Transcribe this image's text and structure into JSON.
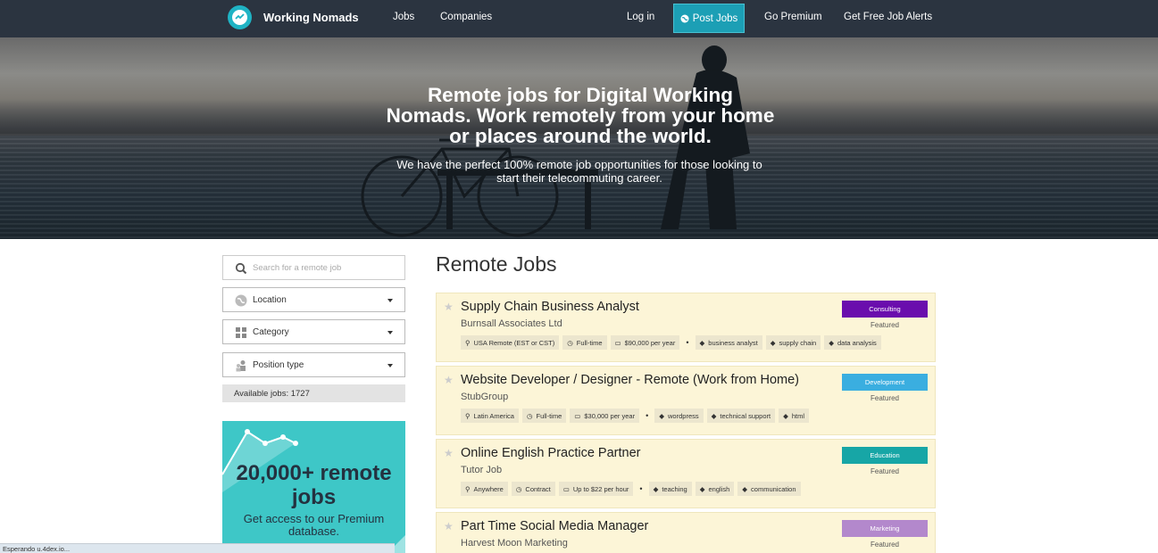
{
  "nav": {
    "brand": "Working Nomads",
    "links": [
      "Jobs",
      "Companies",
      "Log in",
      "Post Jobs",
      "Go Premium",
      "Get Free Job Alerts"
    ]
  },
  "hero": {
    "title": "Remote jobs for Digital Working Nomads. Work remotely from your home or places around the world.",
    "subtitle": "We have the perfect 100% remote job opportunities for those looking to start their telecommuting career."
  },
  "sidebar": {
    "search_placeholder": "Search for a remote job",
    "filters": [
      "Location",
      "Category",
      "Position type"
    ],
    "available": "Available jobs: 1727"
  },
  "promo": {
    "big": "20,000+ remote jobs",
    "small": "Get access to our Premium database."
  },
  "main": {
    "title": "Remote Jobs",
    "jobs": [
      {
        "title": "Supply Chain Business Analyst",
        "company": "Burnsall Associates Ltd",
        "location": "USA Remote (EST or CST)",
        "type": "Full-time",
        "salary": "$90,000 per year",
        "tags": [
          "business analyst",
          "supply chain",
          "data analysis"
        ],
        "category": "Consulting",
        "category_color": "#6a0dad",
        "featured": "Featured"
      },
      {
        "title": "Website Developer / Designer - Remote (Work from Home)",
        "company": "StubGroup",
        "location": "Latin America",
        "type": "Full-time",
        "salary": "$30,000 per year",
        "tags": [
          "wordpress",
          "technical support",
          "html"
        ],
        "category": "Development",
        "category_color": "#3aaee0",
        "featured": "Featured"
      },
      {
        "title": "Online English Practice Partner",
        "company": "Tutor Job",
        "location": "Anywhere",
        "type": "Contract",
        "salary": "Up to $22 per hour",
        "tags": [
          "teaching",
          "english",
          "communication"
        ],
        "category": "Education",
        "category_color": "#17a6a6",
        "featured": "Featured"
      },
      {
        "title": "Part Time Social Media Manager",
        "company": "Harvest Moon Marketing",
        "category": "Marketing",
        "category_color": "#b388cc",
        "featured": "Featured"
      }
    ]
  },
  "status": "Esperando u.4dex.io..."
}
